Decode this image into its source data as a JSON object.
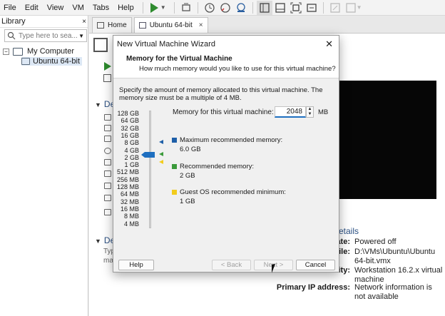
{
  "menu": {
    "items": [
      "File",
      "Edit",
      "View",
      "VM",
      "Tabs",
      "Help"
    ]
  },
  "toolbar": {
    "icons": [
      "power-on-icon",
      "snapshot-icon",
      "revert-snapshot-icon",
      "snapshot-manager-icon",
      "console-view-icon",
      "fullscreen-icon"
    ]
  },
  "library": {
    "title": "Library",
    "close": "×",
    "search_placeholder": "Type here to sea...",
    "tree": {
      "root": "My Computer",
      "toggle": "−",
      "child": "Ubuntu 64-bit"
    }
  },
  "tabs": [
    {
      "label": "Home"
    },
    {
      "label": "Ubuntu 64-bit",
      "close": "×"
    }
  ],
  "vm_page": {
    "devices_header": "De",
    "description_header": "De",
    "description_text_1": "Typ",
    "description_text_2": "ma",
    "details_header": "etails",
    "details": [
      {
        "label": "ate:",
        "value": "Powered off"
      },
      {
        "label": "ile:",
        "value": "D:\\VMs\\Ubuntu\\Ubuntu 64-bit.vmx"
      },
      {
        "label": "ity:",
        "value": "Workstation 16.2.x virtual machine"
      },
      {
        "label": "Primary IP address:",
        "value": "Network information is not available"
      }
    ]
  },
  "dialog": {
    "title": "New Virtual Machine Wizard",
    "close": "✕",
    "header_title": "Memory for the Virtual Machine",
    "header_subtitle": "How much memory would you like to use for this virtual machine?",
    "description": "Specify the amount of memory allocated to this virtual machine. The memory size must be a multiple of 4 MB.",
    "memory_label": "Memory for this virtual machine:",
    "memory_value": "2048",
    "memory_unit": "MB",
    "scale_labels": [
      "128 GB",
      "64 GB",
      "32 GB",
      "16 GB",
      "8 GB",
      "4 GB",
      "2 GB",
      "1 GB",
      "512 MB",
      "256 MB",
      "128 MB",
      "64 MB",
      "32 MB",
      "16 MB",
      "8 MB",
      "4 MB"
    ],
    "slider_selected": "2 GB",
    "legend": [
      {
        "title": "Maximum recommended memory:",
        "value": "6.0 GB",
        "color": "#1e5fa8"
      },
      {
        "title": "Recommended memory:",
        "value": "2 GB",
        "color": "#3a9a3a"
      },
      {
        "title": "Guest OS recommended minimum:",
        "value": "1 GB",
        "color": "#f2cc1c"
      }
    ],
    "buttons": {
      "help": "Help",
      "back": "< Back",
      "next": "Next >",
      "cancel": "Cancel"
    }
  }
}
